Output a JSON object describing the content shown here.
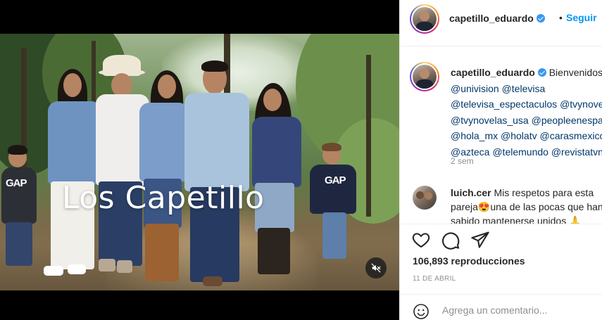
{
  "media": {
    "overlay_title": "Los Capetillo",
    "shirt_text_left": "GAP",
    "shirt_text_right": "GAP",
    "mute_icon": "volume-muted-icon"
  },
  "header": {
    "username": "capetillo_eduardo",
    "separator": "•",
    "follow_label": "Seguir",
    "verified_icon": "verified-badge-icon"
  },
  "caption": {
    "username": "capetillo_eduardo",
    "lines": [
      "Bienvenidos",
      "@univision @televisa",
      "@televisa_espectaculos @tvynovelas",
      "@tvynovelas_usa @peopleenespanol",
      "@hola_mx @holatv @carasmexico",
      "@azteca @telemundo @revistatvnotas"
    ],
    "time": "2 sem"
  },
  "comment": {
    "username": "luich.cer",
    "line1": "Mis respetos para esta",
    "line2": "pareja😍una de las pocas que han",
    "line3": "sabido mantenerse unidos 🙏"
  },
  "actions": {
    "like_icon": "heart-icon",
    "comment_icon": "comment-icon",
    "share_icon": "paper-plane-icon",
    "views": "106,893 reproducciones",
    "date": "11 DE ABRIL"
  },
  "add_comment": {
    "placeholder": "Agrega un comentario...",
    "emoji_icon": "emoji-smile-icon"
  },
  "colors": {
    "accent": "#0095f6",
    "verified": "#3897f0",
    "text": "#262626",
    "muted": "#8e8e8e"
  }
}
